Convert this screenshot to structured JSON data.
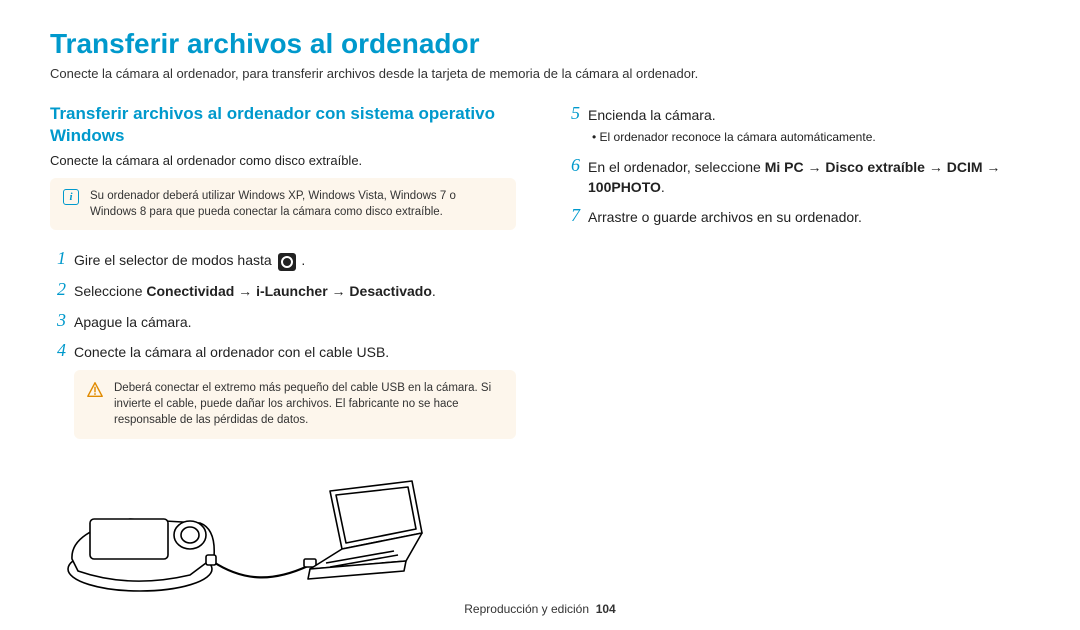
{
  "title": "Transferir archivos al ordenador",
  "intro": "Conecte la cámara al ordenador, para transferir archivos desde la tarjeta de memoria de la cámara al ordenador.",
  "left": {
    "subtitle": "Transferir archivos al ordenador con sistema operativo Windows",
    "subintro": "Conecte la cámara al ordenador como disco extraíble.",
    "info_note": "Su ordenador deberá utilizar Windows XP, Windows Vista, Windows 7 o Windows 8 para que pueda conectar la cámara como disco extraíble.",
    "steps": {
      "s1_pre": "Gire el selector de modos hasta ",
      "s1_post": " .",
      "s2_pre": "Seleccione ",
      "s2_bold": "Conectividad → i-Launcher → Desactivado",
      "s2_post": ".",
      "s3": "Apague la cámara.",
      "s4": "Conecte la cámara al ordenador con el cable USB."
    },
    "warn_note": "Deberá conectar el extremo más pequeño del cable USB en la cámara. Si invierte el cable, puede dañar los archivos. El fabricante no se hace responsable de las pérdidas de datos."
  },
  "right": {
    "steps": {
      "s5": "Encienda la cámara.",
      "s5_sub": "El ordenador reconoce la cámara automáticamente.",
      "s6_pre": "En el ordenador, seleccione ",
      "s6_bold": "Mi PC → Disco extraíble → DCIM → 100PHOTO",
      "s6_post": ".",
      "s7": "Arrastre o guarde archivos en su ordenador."
    }
  },
  "nums": {
    "n1": "1",
    "n2": "2",
    "n3": "3",
    "n4": "4",
    "n5": "5",
    "n6": "6",
    "n7": "7"
  },
  "footer": {
    "section": "Reproducción y edición",
    "page": "104"
  },
  "icons": {
    "info_glyph": "i"
  }
}
